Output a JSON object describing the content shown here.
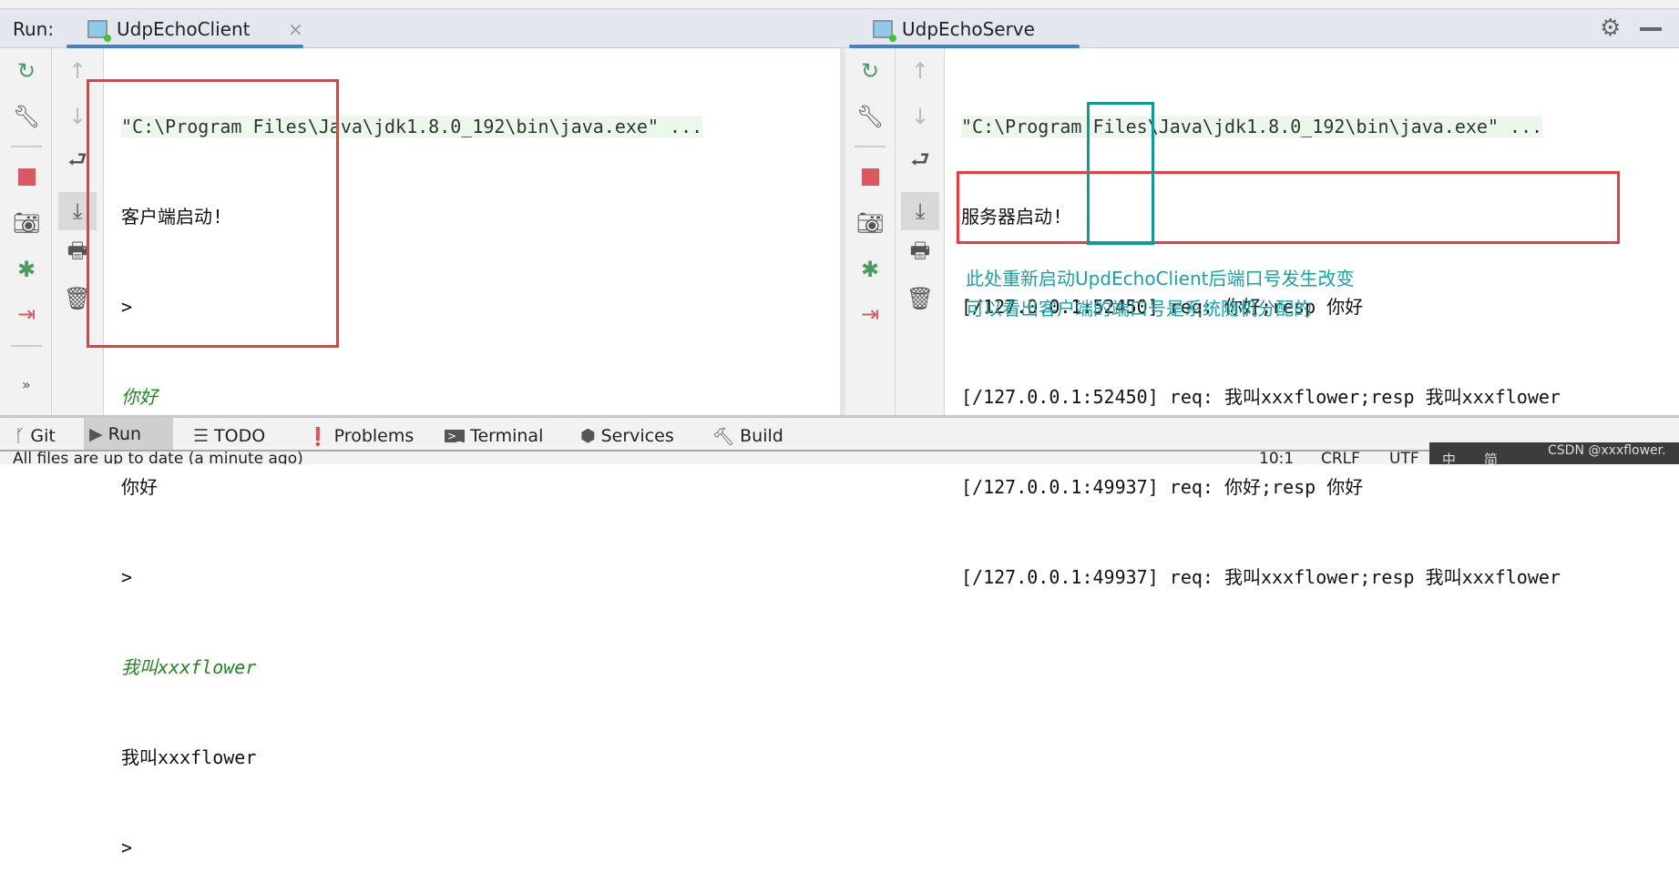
{
  "colors": {
    "accent": "#4083c9",
    "red_box": "#ee3b3b",
    "teal_box": "#0e9a95",
    "annotation": "#16a3a3",
    "user_input": "#1d8a1d"
  },
  "run_label": "Run:",
  "left": {
    "tab": "UdpEchoClient",
    "close": "×",
    "lines": [
      "\"C:\\Program Files\\Java\\jdk1.8.0_192\\bin\\java.exe\" ...",
      "客户端启动!",
      ">",
      "你好",
      "你好",
      ">",
      "我叫xxxflower",
      "我叫xxxflower",
      ">"
    ],
    "more": "»"
  },
  "right": {
    "tab": "UdpEchoServe",
    "lines": [
      "\"C:\\Program Files\\Java\\jdk1.8.0_192\\bin\\java.exe\" ...",
      "服务器启动!",
      "[/127.0.0.1:52450] req: 你好;resp 你好",
      "[/127.0.0.1:52450] req: 我叫xxxflower;resp 我叫xxxflower",
      "[/127.0.0.1:49937] req: 你好;resp 你好",
      "[/127.0.0.1:49937] req: 我叫xxxflower;resp 我叫xxxflower"
    ],
    "annotation": [
      "此处重新启动UpdEchoClient后端口号发生改变",
      "可以看出客户端的端口号是系统随机分配的"
    ]
  },
  "toolwindows": [
    {
      "label": "Git",
      "icon": "git-branch-icon"
    },
    {
      "label": "Run",
      "icon": "run-icon"
    },
    {
      "label": "TODO",
      "icon": "list-icon"
    },
    {
      "label": "Problems",
      "icon": "warning-icon"
    },
    {
      "label": "Terminal",
      "icon": "terminal-icon"
    },
    {
      "label": "Services",
      "icon": "services-icon"
    },
    {
      "label": "Build",
      "icon": "hammer-icon"
    }
  ],
  "status": {
    "message": "All files are up to date (a minute ago)",
    "position": "10:1",
    "line_sep": "CRLF",
    "encoding": "UTF",
    "watermark": "CSDN @xxxflower.",
    "ime": "中",
    "ime2": "简"
  }
}
